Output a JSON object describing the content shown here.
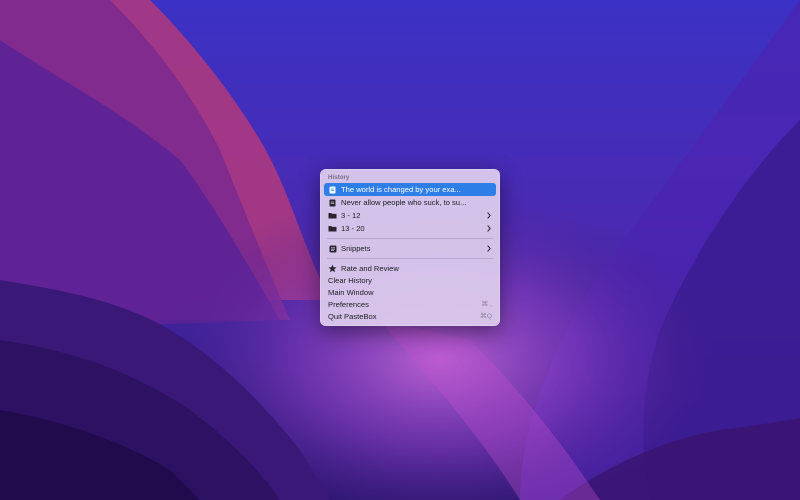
{
  "menu": {
    "section_title": "History",
    "history_items": [
      {
        "label": "The world is changed by your exa...",
        "icon": "doc-icon"
      },
      {
        "label": "Never allow people who suck, to su...",
        "icon": "doc-icon"
      }
    ],
    "folders": [
      {
        "label": "3 - 12",
        "icon": "folder-icon"
      },
      {
        "label": "13 - 20",
        "icon": "folder-icon"
      }
    ],
    "snippets": {
      "label": "Snippets",
      "icon": "snippets-icon"
    },
    "rate": {
      "label": "Rate and Review",
      "icon": "star-icon"
    },
    "clear_history": "Clear History",
    "main_window": "Main Window",
    "preferences": {
      "label": "Preferences",
      "shortcut": "⌘ ,"
    },
    "quit": {
      "label": "Quit PasteBox",
      "shortcut": "⌘Q"
    }
  },
  "colors": {
    "selection": "#2d7ee6",
    "menu_background": "#decdee",
    "wallpaper_top": "#3a2fb8",
    "wallpaper_bottom": "#2a0d55"
  }
}
